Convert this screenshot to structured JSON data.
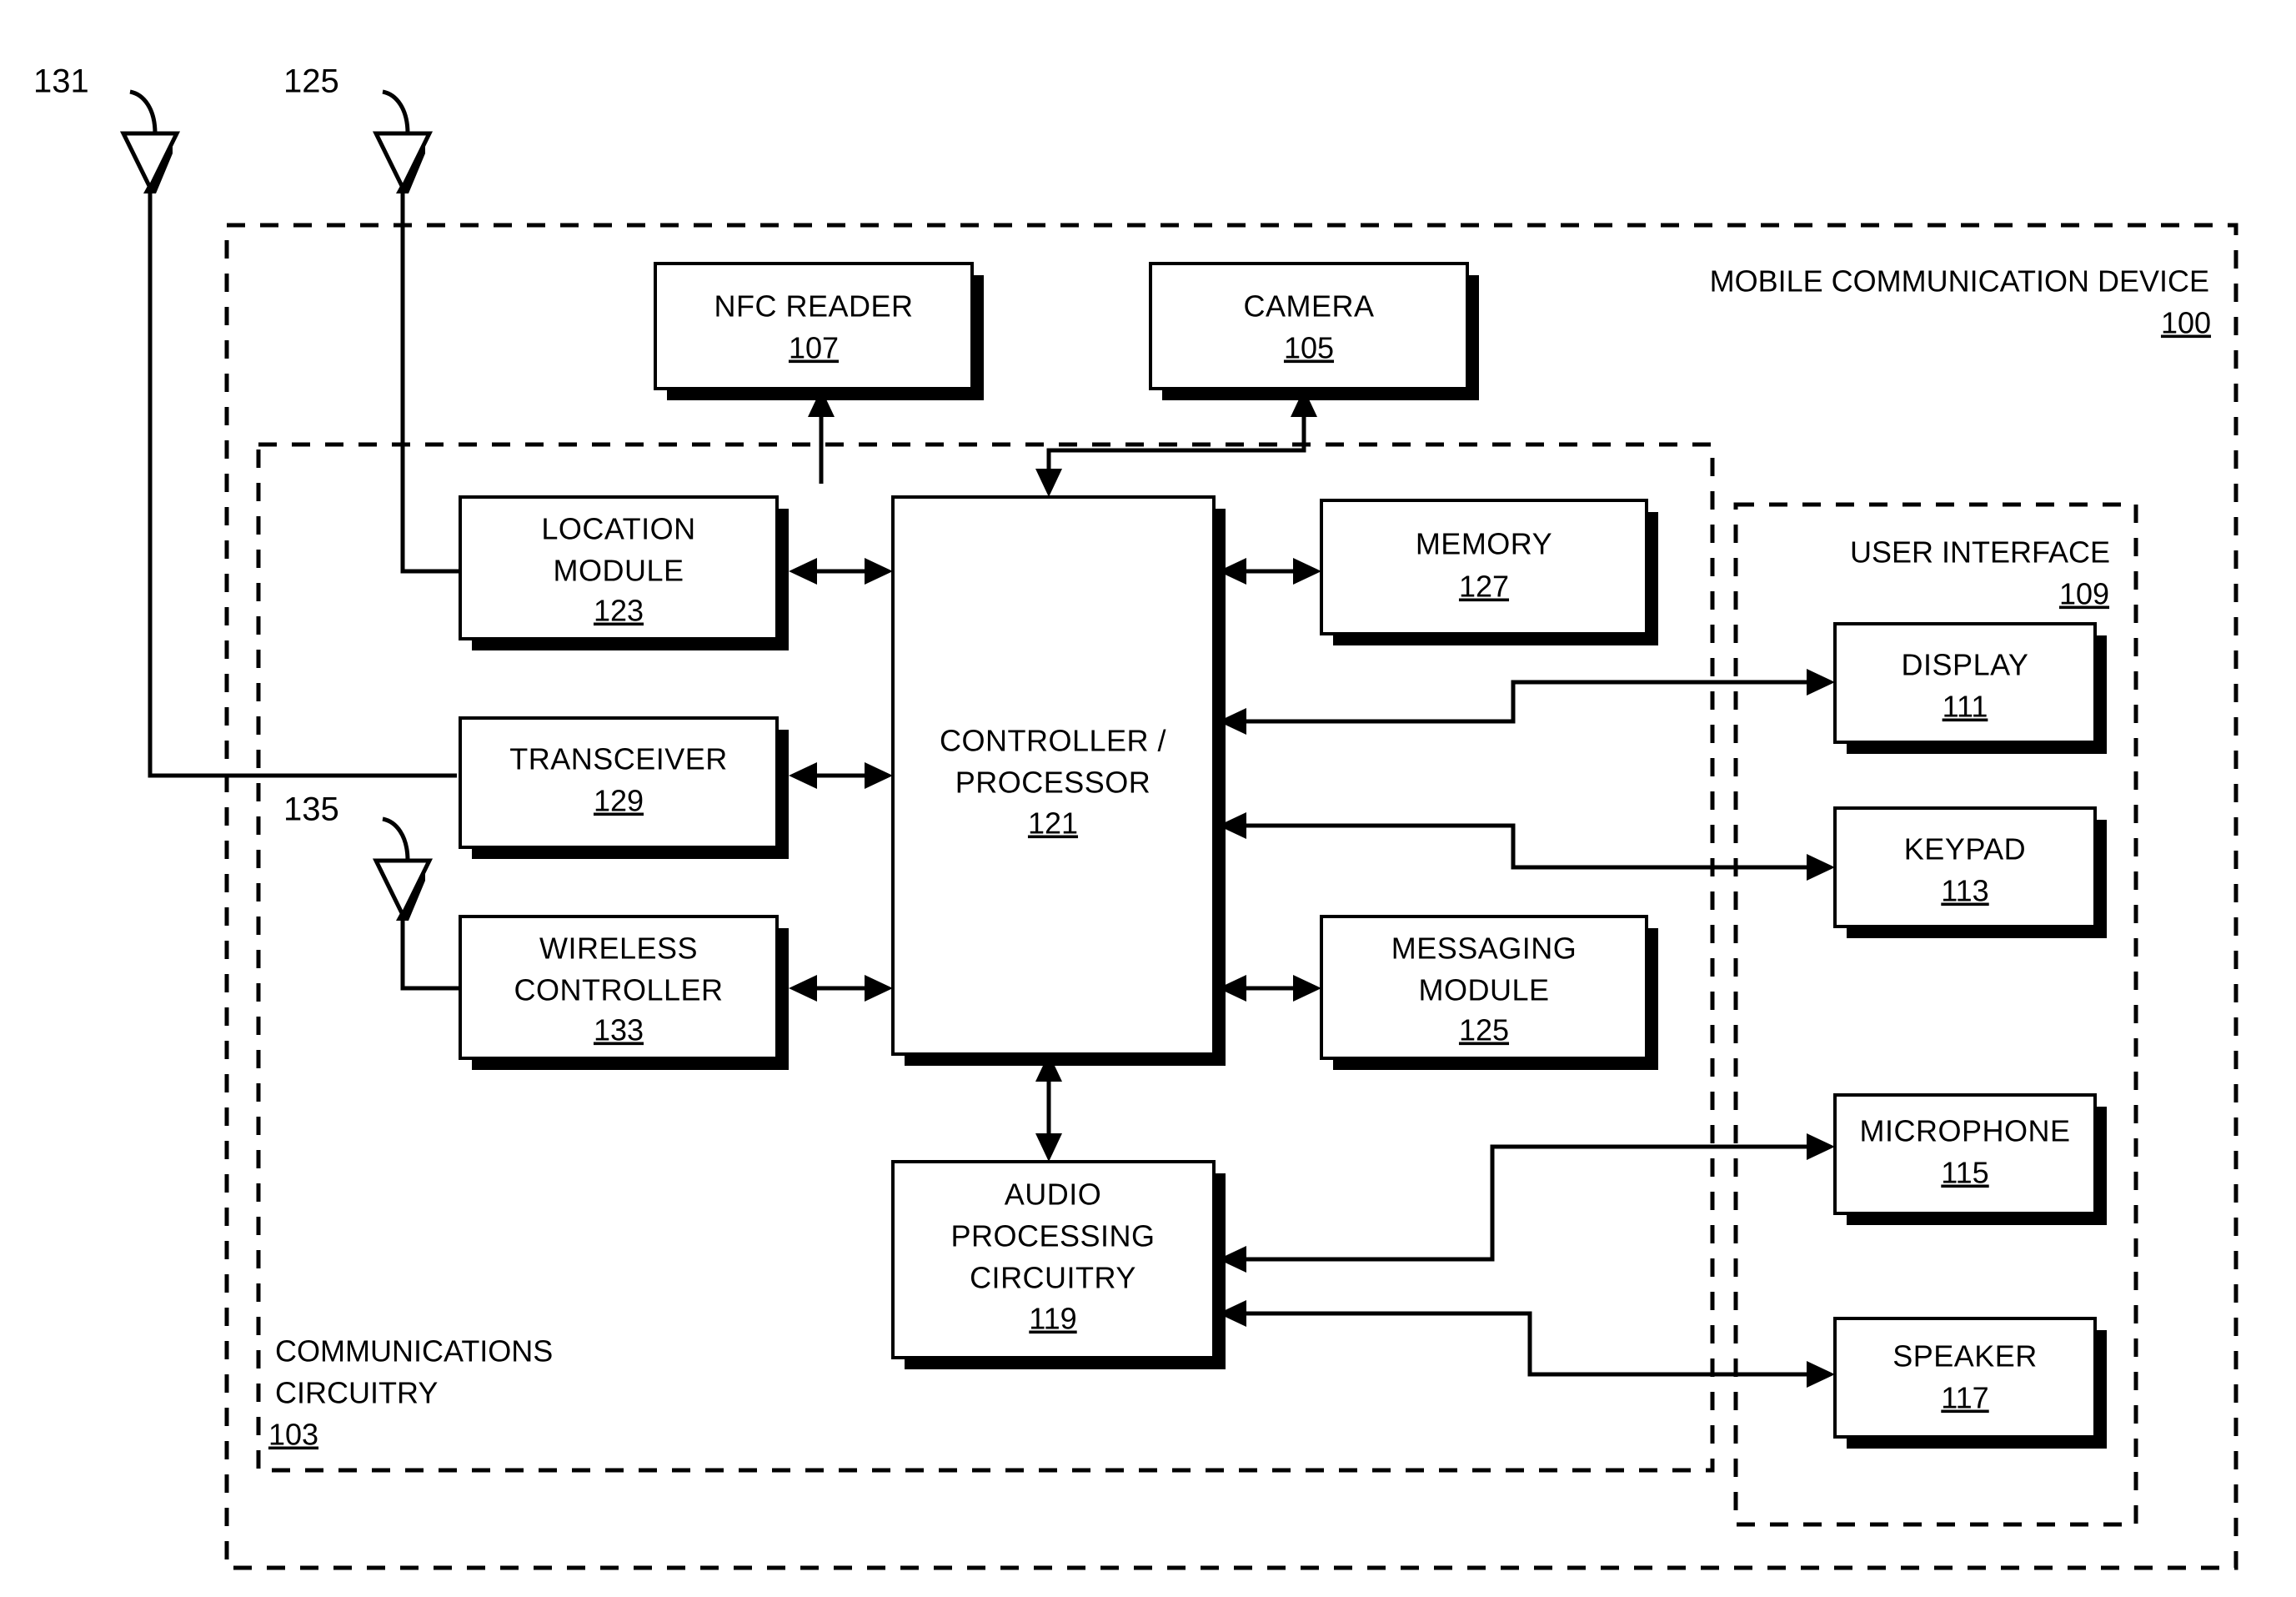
{
  "figure": {
    "type": "patent-block-diagram",
    "subject": "Mobile communication device architecture"
  },
  "groups": [
    {
      "id": "device",
      "label": "MOBILE COMMUNICATION DEVICE",
      "ref": "100"
    },
    {
      "id": "comms",
      "label_line1": "COMMUNICATIONS",
      "label_line2": "CIRCUITRY",
      "ref": "103"
    },
    {
      "id": "ui",
      "label": "USER INTERFACE",
      "ref": "109"
    }
  ],
  "blocks": [
    {
      "id": "nfc_reader",
      "lines": [
        "NFC READER"
      ],
      "ref": "107"
    },
    {
      "id": "camera",
      "lines": [
        "CAMERA"
      ],
      "ref": "105"
    },
    {
      "id": "location",
      "lines": [
        "LOCATION",
        "MODULE"
      ],
      "ref": "123"
    },
    {
      "id": "transceiver",
      "lines": [
        "TRANSCEIVER"
      ],
      "ref": "129"
    },
    {
      "id": "wireless",
      "lines": [
        "WIRELESS",
        "CONTROLLER"
      ],
      "ref": "133"
    },
    {
      "id": "controller",
      "lines": [
        "CONTROLLER /",
        "PROCESSOR"
      ],
      "ref": "121"
    },
    {
      "id": "memory",
      "lines": [
        "MEMORY"
      ],
      "ref": "127"
    },
    {
      "id": "messaging",
      "lines": [
        "MESSAGING",
        "MODULE"
      ],
      "ref": "125"
    },
    {
      "id": "audio",
      "lines": [
        "AUDIO",
        "PROCESSING",
        "CIRCUITRY"
      ],
      "ref": "119"
    },
    {
      "id": "display",
      "lines": [
        "DISPLAY"
      ],
      "ref": "111"
    },
    {
      "id": "keypad",
      "lines": [
        "KEYPAD"
      ],
      "ref": "113"
    },
    {
      "id": "microphone",
      "lines": [
        "MICROPHONE"
      ],
      "ref": "115"
    },
    {
      "id": "speaker",
      "lines": [
        "SPEAKER"
      ],
      "ref": "117"
    }
  ],
  "antennas": [
    {
      "id": "antenna_131",
      "ref": "131"
    },
    {
      "id": "antenna_125",
      "ref": "125"
    },
    {
      "id": "antenna_135",
      "ref": "135"
    }
  ],
  "colors": {
    "ink": "#000000",
    "paper": "#ffffff"
  }
}
